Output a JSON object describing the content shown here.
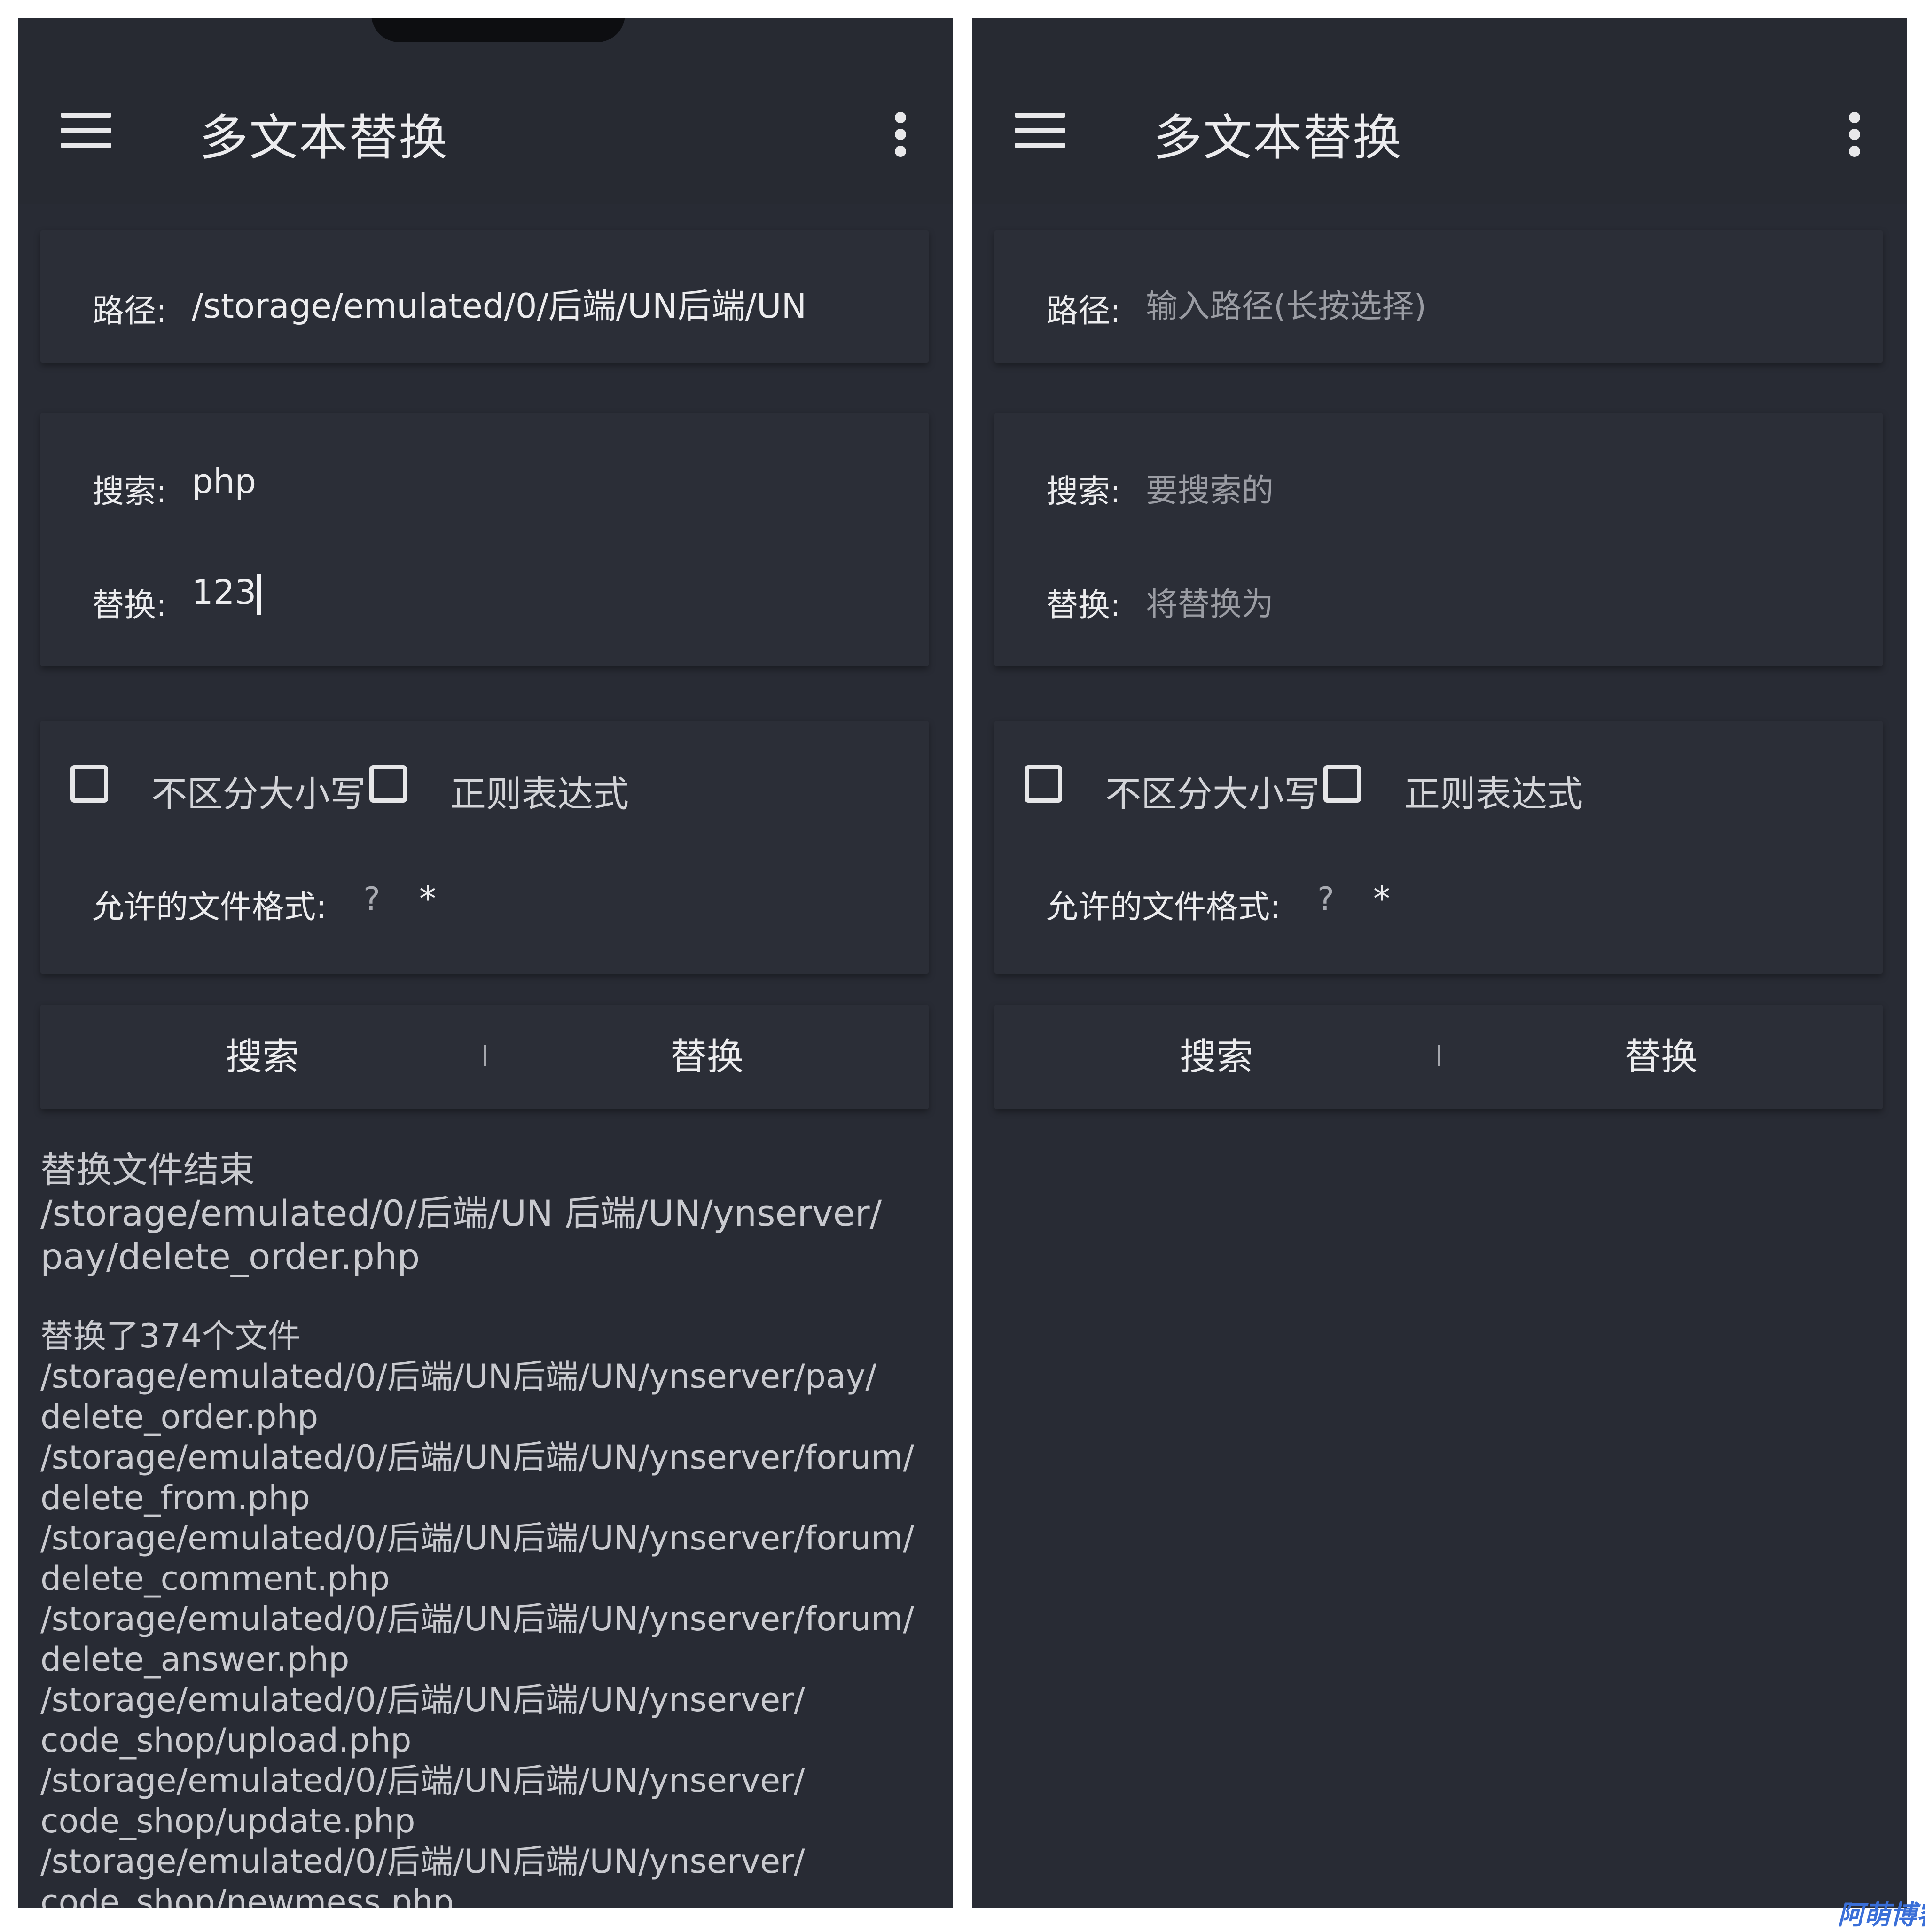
{
  "left": {
    "appbar": {
      "title": "多文本替换",
      "menu_icon": "hamburger-menu-icon",
      "more_icon": "more-vert-icon"
    },
    "path": {
      "label": "路径:",
      "value": "/storage/emulated/0/后端/UN后端/UN"
    },
    "search": {
      "label": "搜索:",
      "value": "php"
    },
    "replace": {
      "label": "替换:",
      "value": "123"
    },
    "options": {
      "case_insensitive": "不区分大小写",
      "regex": "正则表达式",
      "format_label": "允许的文件格式:",
      "format_help": "?",
      "format_value": "*"
    },
    "buttons": {
      "search": "搜索",
      "replace": "替换"
    },
    "result": {
      "summary": "替换文件结束\n/storage/emulated/0/后端/UN 后端/UN/ynserver/\npay/delete_order.php",
      "log": "替换了374个文件\n/storage/emulated/0/后端/UN后端/UN/ynserver/pay/\ndelete_order.php\n/storage/emulated/0/后端/UN后端/UN/ynserver/forum/\ndelete_from.php\n/storage/emulated/0/后端/UN后端/UN/ynserver/forum/\ndelete_comment.php\n/storage/emulated/0/后端/UN后端/UN/ynserver/forum/\ndelete_answer.php\n/storage/emulated/0/后端/UN后端/UN/ynserver/\ncode_shop/upload.php\n/storage/emulated/0/后端/UN后端/UN/ynserver/\ncode_shop/update.php\n/storage/emulated/0/后端/UN后端/UN/ynserver/\ncode_shop/newmess.php"
    }
  },
  "right": {
    "appbar": {
      "title": "多文本替换",
      "menu_icon": "hamburger-menu-icon",
      "more_icon": "more-vert-icon"
    },
    "path": {
      "label": "路径:",
      "placeholder": "输入路径(长按选择)"
    },
    "search": {
      "label": "搜索:",
      "placeholder": "要搜索的"
    },
    "replace": {
      "label": "替换:",
      "placeholder": "将替换为"
    },
    "options": {
      "case_insensitive": "不区分大小写",
      "regex": "正则表达式",
      "format_label": "允许的文件格式:",
      "format_help": "?",
      "format_value": "*"
    },
    "buttons": {
      "search": "搜索",
      "replace": "替换"
    }
  },
  "watermark": "阿萌博客",
  "colors": {
    "background": "#282b34",
    "appbar": "#272a32",
    "card": "#2b2e37",
    "text": "#ececee",
    "muted_text": "#9a9ca3"
  }
}
